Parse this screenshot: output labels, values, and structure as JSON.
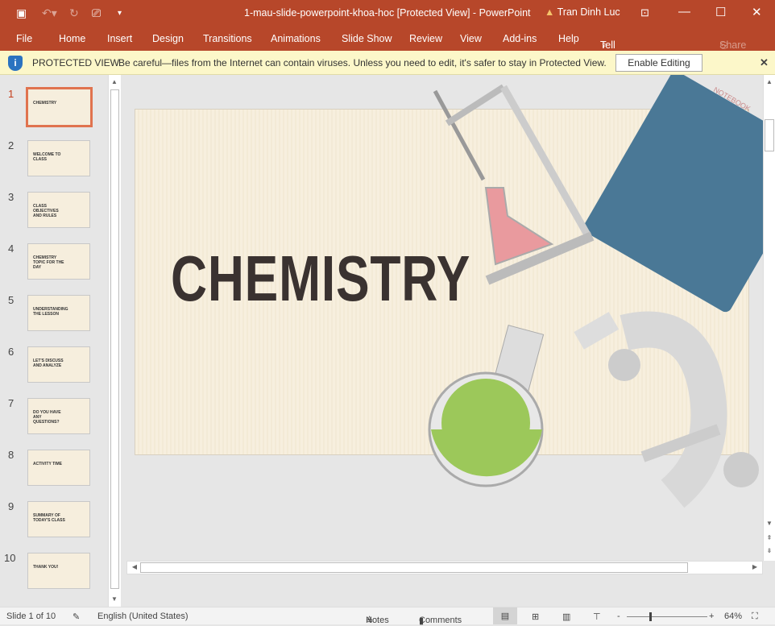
{
  "titlebar": {
    "title": "1-mau-slide-powerpoint-khoa-hoc [Protected View]  -  PowerPoint",
    "user": "Tran Dinh Luc"
  },
  "ribbon": {
    "tabs": [
      "File",
      "Home",
      "Insert",
      "Design",
      "Transitions",
      "Animations",
      "Slide Show",
      "Review",
      "View",
      "Add-ins",
      "Help",
      "Tell me"
    ],
    "share": "Share"
  },
  "protected": {
    "label": "PROTECTED VIEW",
    "message": "Be careful—files from the Internet can contain viruses. Unless you need to edit, it's safer to stay in Protected View.",
    "button": "Enable Editing"
  },
  "thumbnails": [
    {
      "n": "1",
      "title": "CHEMISTRY"
    },
    {
      "n": "2",
      "title": "WELCOME TO CLASS"
    },
    {
      "n": "3",
      "title": "CLASS OBJECTIVES AND RULES"
    },
    {
      "n": "4",
      "title": "CHEMISTRY TOPIC FOR THE DAY"
    },
    {
      "n": "5",
      "title": "UNDERSTANDING THE LESSON"
    },
    {
      "n": "6",
      "title": "LET'S DISCUSS AND ANALYZE"
    },
    {
      "n": "7",
      "title": "DO YOU HAVE ANY QUESTIONS?"
    },
    {
      "n": "8",
      "title": "ACTIVITY TIME"
    },
    {
      "n": "9",
      "title": "SUMMARY OF TODAY'S CLASS"
    },
    {
      "n": "10",
      "title": "THANK YOU!"
    }
  ],
  "slide": {
    "title": "CHEMISTRY"
  },
  "status": {
    "slide": "Slide 1 of 10",
    "language": "English (United States)",
    "notes": "Notes",
    "comments": "Comments",
    "zoom": "64%"
  }
}
